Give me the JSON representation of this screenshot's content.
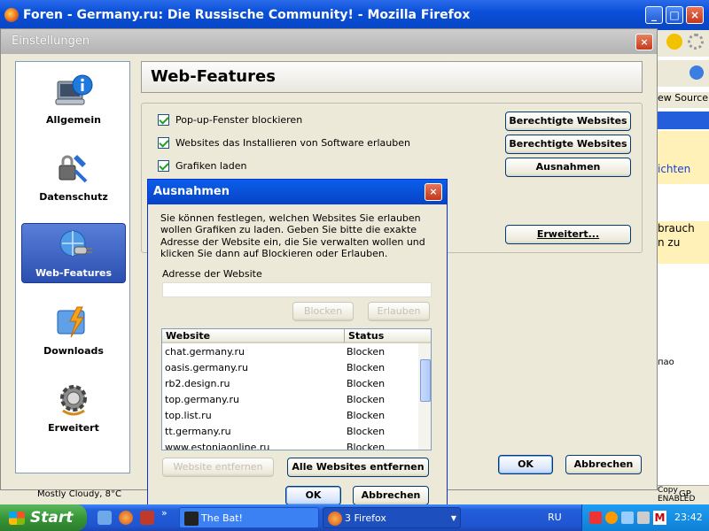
{
  "firefox": {
    "title": "Foren - Germany.ru: Die Russische Community! - Mozilla Firefox",
    "strip": [
      "ew Source",
      "ichten",
      "brauch",
      "n zu",
      "пао"
    ],
    "status_text": "Mostly Cloudy, 8°C",
    "status_right": "Copy ENABLED",
    "status_gp": "GP"
  },
  "settings": {
    "title": "Einstellungen",
    "categories": [
      {
        "label": "Allgemein"
      },
      {
        "label": "Datenschutz"
      },
      {
        "label": "Web-Features"
      },
      {
        "label": "Downloads"
      },
      {
        "label": "Erweitert"
      }
    ],
    "header": "Web-Features",
    "features": [
      {
        "label": "Pop-up-Fenster blockieren",
        "checked": true,
        "button": "Berechtigte Websites"
      },
      {
        "label": "Websites das Installieren von Software erlauben",
        "checked": true,
        "button": "Berechtigte Websites"
      },
      {
        "label": "Grafiken laden",
        "checked": true,
        "button": "Ausnahmen"
      }
    ],
    "advanced_button": "Erweitert...",
    "ok": "OK",
    "cancel": "Abbrechen"
  },
  "ausnahmen": {
    "title": "Ausnahmen",
    "description": "Sie können festlegen, welchen Websites Sie erlauben wollen Grafiken zu laden. Geben Sie bitte die exakte Adresse der Website ein, die Sie verwalten wollen und klicken Sie dann auf Blockieren oder Erlauben.",
    "address_label": "Adresse der Website",
    "address_value": "",
    "block_button": "Blocken",
    "allow_button": "Erlauben",
    "columns": [
      "Website",
      "Status"
    ],
    "rows": [
      {
        "site": "chat.germany.ru",
        "status": "Blocken"
      },
      {
        "site": "oasis.germany.ru",
        "status": "Blocken"
      },
      {
        "site": "rb2.design.ru",
        "status": "Blocken"
      },
      {
        "site": "top.germany.ru",
        "status": "Blocken"
      },
      {
        "site": "top.list.ru",
        "status": "Blocken"
      },
      {
        "site": "tt.germany.ru",
        "status": "Blocken"
      },
      {
        "site": "www.estoniaonline.ru",
        "status": "Blocken"
      }
    ],
    "remove_site": "Website entfernen",
    "remove_all": "Alle Websites entfernen",
    "ok": "OK",
    "cancel": "Abbrechen"
  },
  "taskbar": {
    "start": "Start",
    "task1": "The Bat!",
    "task2": "3 Firefox",
    "lang": "RU",
    "clock": "23:42"
  }
}
